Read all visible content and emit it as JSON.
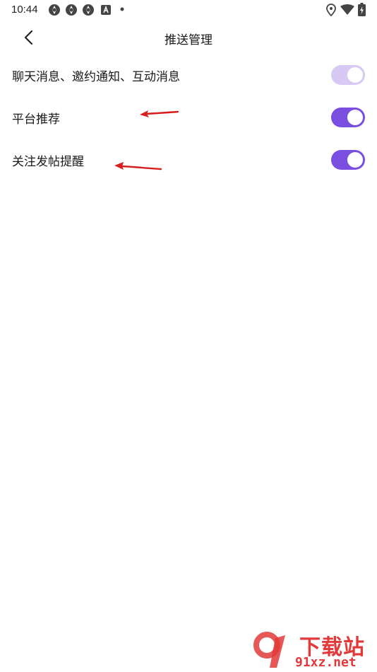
{
  "status_bar": {
    "time": "10:44",
    "icons_left": [
      "aperture-icon",
      "aperture-icon",
      "aperture-icon",
      "font-icon",
      "dot-icon"
    ],
    "icons_right": [
      "location-icon",
      "wifi-icon",
      "battery-charging-icon"
    ]
  },
  "nav": {
    "back_icon": "chevron-left-icon",
    "title": "推送管理"
  },
  "settings": [
    {
      "label": "聊天消息、邀约通知、互动消息",
      "enabled": true,
      "style": "light"
    },
    {
      "label": "平台推荐",
      "enabled": true,
      "style": "solid"
    },
    {
      "label": "关注发帖提醒",
      "enabled": true,
      "style": "solid"
    }
  ],
  "colors": {
    "accent": "#7a4fe0",
    "accent_light": "#d7c9f3",
    "annotation_red": "#d81f1f",
    "watermark_red": "#e23a3a"
  },
  "watermark": {
    "top_text": "下载站",
    "bottom_text": "91xz.net"
  }
}
